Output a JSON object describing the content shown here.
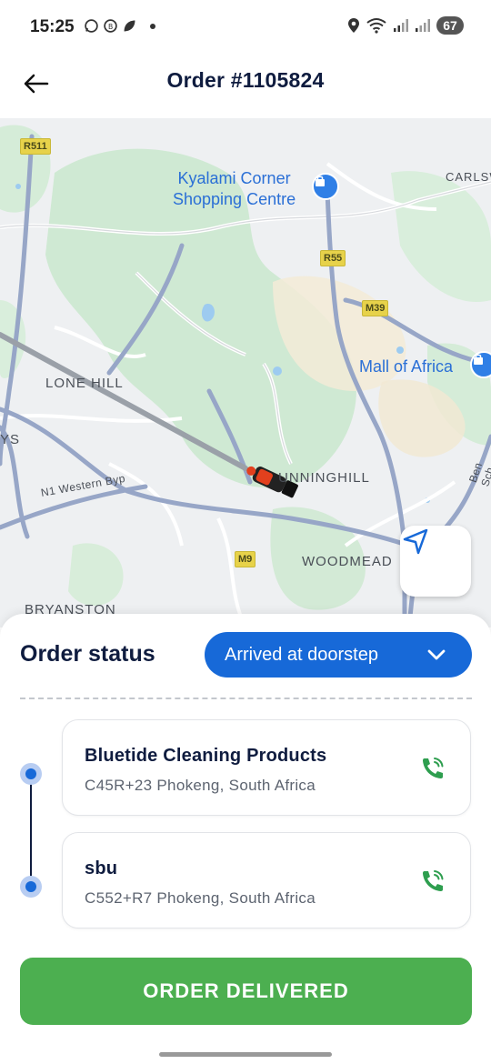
{
  "status_bar": {
    "time": "15:25",
    "battery": "67",
    "left_icons": [
      "whatsapp-icon",
      "whatsapp-business-icon",
      "leaf-icon"
    ],
    "right_icons": [
      "location-icon",
      "wifi-icon",
      "signal-icon",
      "signal-icon"
    ]
  },
  "header": {
    "title": "Order #1105824",
    "back_icon": "arrow-left-icon"
  },
  "map": {
    "labels": {
      "lone_hill": "LONE HILL",
      "sunninghill": "UNNINGHILL",
      "woodmead": "WOODMEAD",
      "bryanston": "BRYANSTON",
      "carlsw": "CARLSW",
      "ys": "YS",
      "ben_sch": "Ben Sch",
      "n1_western_byp": "N1 Western Byp"
    },
    "pois": {
      "kyalami_line1": "Kyalami Corner",
      "kyalami_line2": "Shopping Centre",
      "mall_of_africa": "Mall of Africa"
    },
    "road_shields": {
      "r511": "R511",
      "r55": "R55",
      "m39": "M39",
      "m9": "M9"
    },
    "locate_icon": "navigation-arrow-icon"
  },
  "sheet": {
    "order_status_label": "Order status",
    "status_value": "Arrived at doorstep",
    "stops": [
      {
        "name": "Bluetide Cleaning Products",
        "address": "C45R+23 Phokeng, South Africa"
      },
      {
        "name": "sbu",
        "address": "C552+R7 Phokeng, South Africa"
      }
    ],
    "primary_button": "ORDER DELIVERED"
  },
  "colors": {
    "accent_blue": "#1769d8",
    "success_green": "#4caf50",
    "call_green": "#2e9e4f",
    "text_dark": "#0f1c3f"
  }
}
